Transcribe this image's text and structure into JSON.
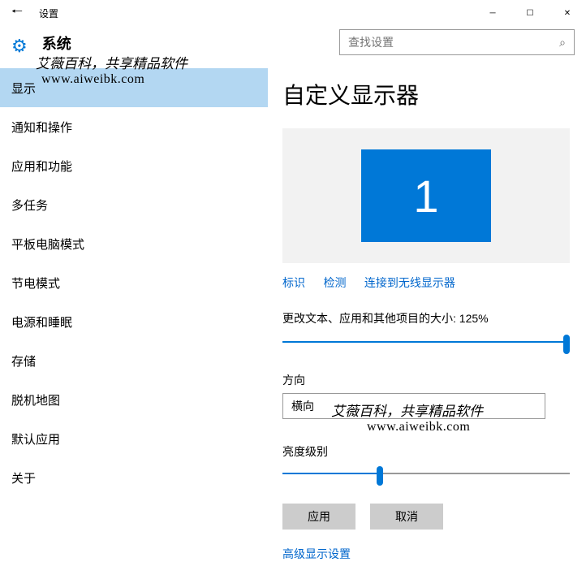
{
  "titlebar": {
    "title": "设置"
  },
  "header": {
    "title": "系统"
  },
  "search": {
    "placeholder": "查找设置"
  },
  "watermark": {
    "line1": "艾薇百科，共享精品软件",
    "line2": "www.aiweibk.com"
  },
  "sidebar": {
    "items": [
      {
        "label": "显示"
      },
      {
        "label": "通知和操作"
      },
      {
        "label": "应用和功能"
      },
      {
        "label": "多任务"
      },
      {
        "label": "平板电脑模式"
      },
      {
        "label": "节电模式"
      },
      {
        "label": "电源和睡眠"
      },
      {
        "label": "存储"
      },
      {
        "label": "脱机地图"
      },
      {
        "label": "默认应用"
      },
      {
        "label": "关于"
      }
    ]
  },
  "main": {
    "title": "自定义显示器",
    "monitor_number": "1",
    "links": {
      "identify": "标识",
      "detect": "检测",
      "wireless": "连接到无线显示器"
    },
    "scale": {
      "label": "更改文本、应用和其他项目的大小: 125%",
      "percent": 100
    },
    "orientation": {
      "label": "方向",
      "value": "横向"
    },
    "brightness": {
      "label": "亮度级别",
      "percent": 34
    },
    "buttons": {
      "apply": "应用",
      "cancel": "取消"
    },
    "advanced_link": "高级显示设置"
  }
}
